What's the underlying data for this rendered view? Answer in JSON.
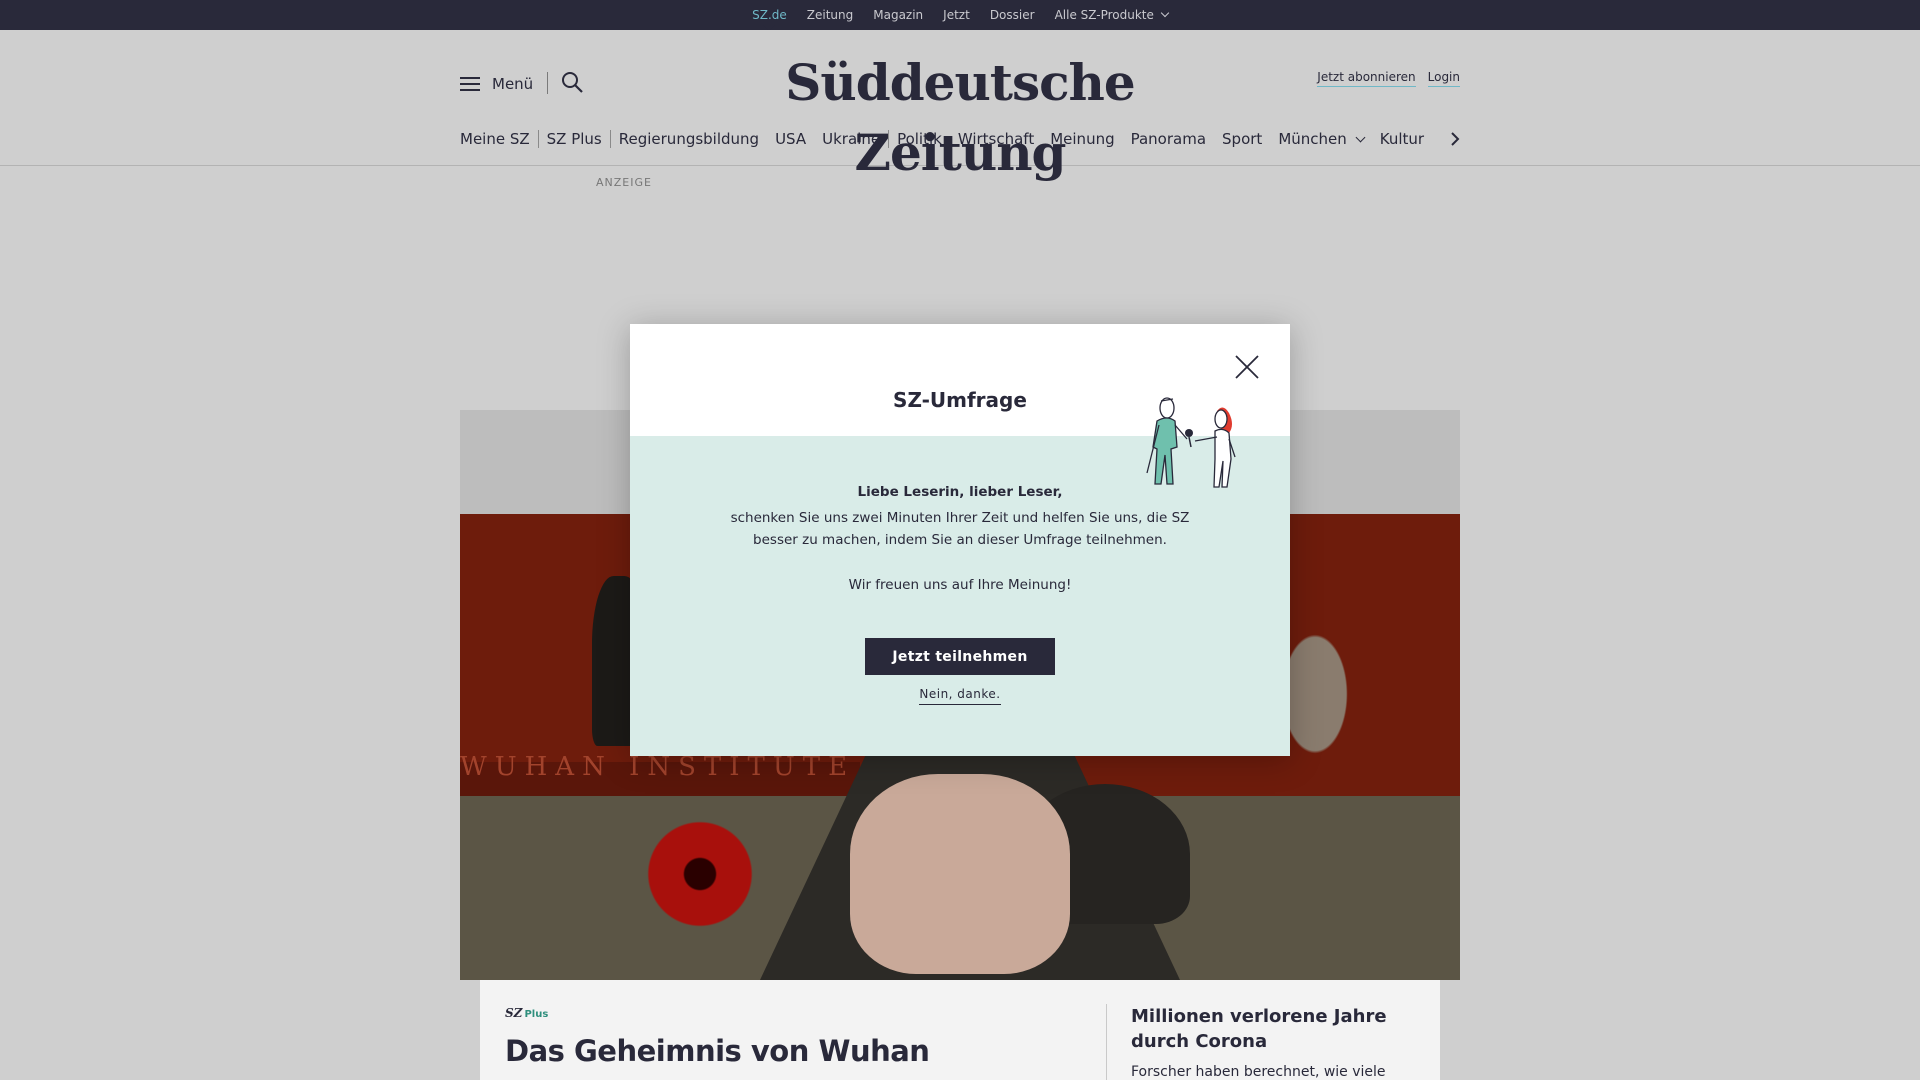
{
  "topbar": {
    "items": [
      "SZ.de",
      "Zeitung",
      "Magazin",
      "Jetzt",
      "Dossier",
      "Alle SZ-Produkte"
    ],
    "active": "SZ.de"
  },
  "header": {
    "menu_label": "Menü",
    "logo": "Süddeutsche Zeitung",
    "subscribe_label": "Jetzt abonnieren",
    "login_label": "Login"
  },
  "section_nav": {
    "items": [
      "Meine SZ",
      "SZ Plus",
      "Regierungsbildung",
      "USA",
      "Ukraine",
      "Politik",
      "Wirtschaft",
      "Meinung",
      "Panorama",
      "Sport",
      "München",
      "Kultur"
    ]
  },
  "ad_label": "ANZEIGE",
  "hero": {
    "image_text": "WUHAN INSTITUTE"
  },
  "teaser": {
    "brand_sz": "SZ",
    "brand_plus": "Plus",
    "title": "Das Geheimnis von Wuhan",
    "side_title": "Millionen verlorene Jahre durch Corona",
    "side_teaser": "Forscher haben berechnet, wie viele"
  },
  "modal": {
    "title": "SZ-Umfrage",
    "greeting": "Liebe Leserin, lieber Leser,",
    "message": "schenken Sie uns zwei Minuten Ihrer Zeit und helfen Sie uns, die SZ besser zu machen, indem Sie an dieser Umfrage teilnehmen.",
    "message2": "Wir freuen uns auf Ihre Meinung!",
    "cta_label": "Jetzt teilnehmen",
    "decline_label": "Nein, danke."
  },
  "colors": {
    "brand_dark": "#29293a",
    "accent_teal": "#6fb8c7",
    "modal_body": "#d9ece8",
    "sz_plus_green": "#2f8f7d"
  }
}
